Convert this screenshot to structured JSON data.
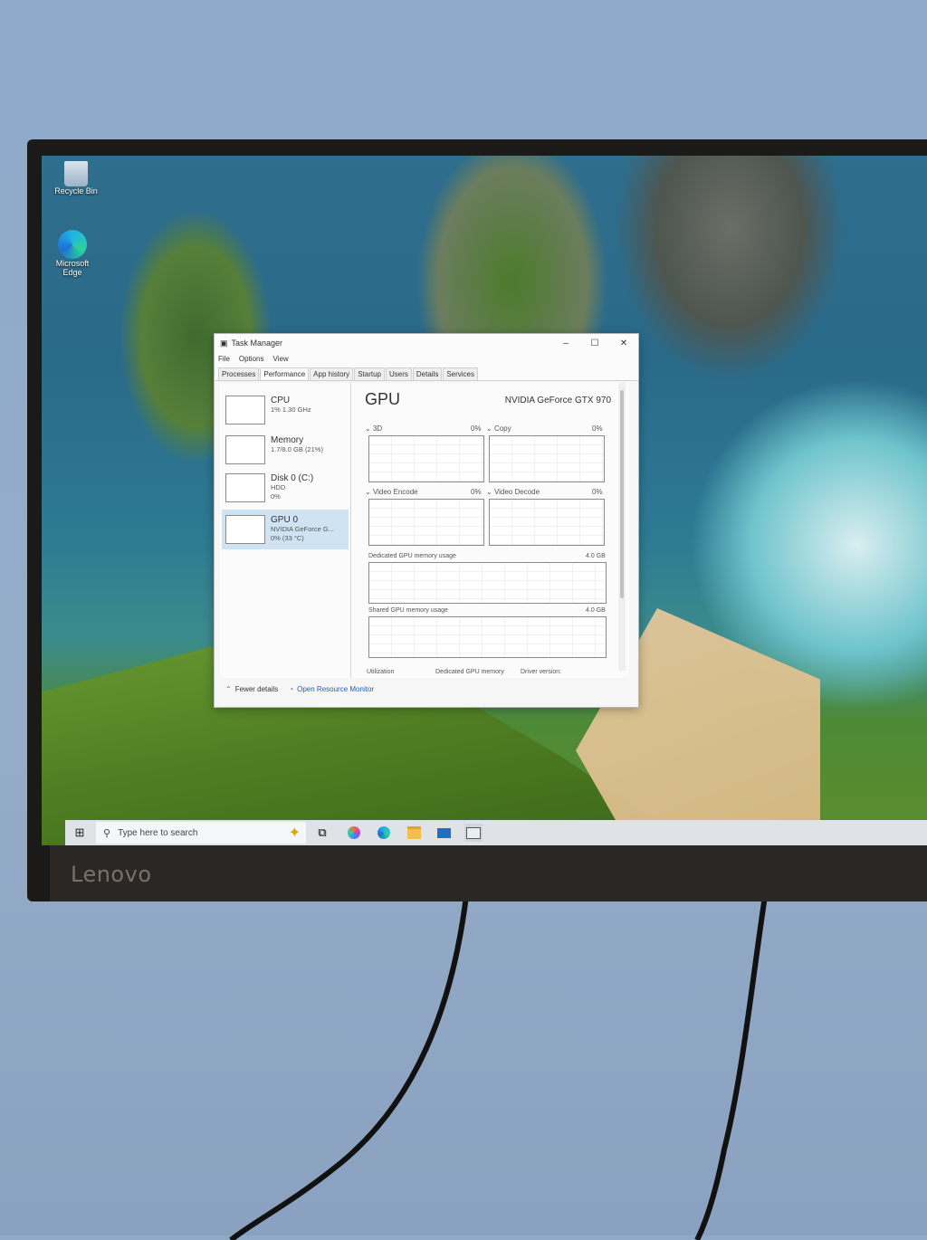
{
  "monitor": {
    "brand": "Lenovo"
  },
  "desktop": {
    "icons": [
      {
        "label": "Recycle Bin",
        "icon": "recycle-bin-icon"
      },
      {
        "label": "Microsoft Edge",
        "icon": "edge-icon"
      }
    ]
  },
  "taskbar": {
    "search_placeholder": "Type here to search",
    "apps": [
      "task-view-icon",
      "copilot-icon",
      "edge-icon",
      "file-explorer-icon",
      "mail-icon",
      "task-manager-icon"
    ]
  },
  "task_manager": {
    "title": "Task Manager",
    "menu": [
      "File",
      "Options",
      "View"
    ],
    "tabs": [
      "Processes",
      "Performance",
      "App history",
      "Startup",
      "Users",
      "Details",
      "Services"
    ],
    "active_tab": "Performance",
    "sidebar": [
      {
        "title": "CPU",
        "sub1": "1% 1.30 GHz",
        "sub2": ""
      },
      {
        "title": "Memory",
        "sub1": "1.7/8.0 GB (21%)",
        "sub2": ""
      },
      {
        "title": "Disk 0 (C:)",
        "sub1": "HDD",
        "sub2": "0%"
      },
      {
        "title": "GPU 0",
        "sub1": "NVIDIA GeForce G...",
        "sub2": "0% (33 °C)"
      }
    ],
    "gpu": {
      "title": "GPU",
      "name": "NVIDIA GeForce GTX 970",
      "engines": [
        {
          "label": "3D",
          "value": "0%"
        },
        {
          "label": "Copy",
          "value": "0%"
        },
        {
          "label": "Video Encode",
          "value": "0%"
        },
        {
          "label": "Video Decode",
          "value": "0%"
        }
      ],
      "dedicated_label": "Dedicated GPU memory usage",
      "dedicated_max": "4.0 GB",
      "shared_label": "Shared GPU memory usage",
      "shared_max": "4.0 GB",
      "stats": [
        "Utilization",
        "Dedicated GPU memory",
        "Driver version:"
      ]
    },
    "footer": {
      "fewer": "Fewer details",
      "monitor": "Open Resource Monitor"
    }
  }
}
